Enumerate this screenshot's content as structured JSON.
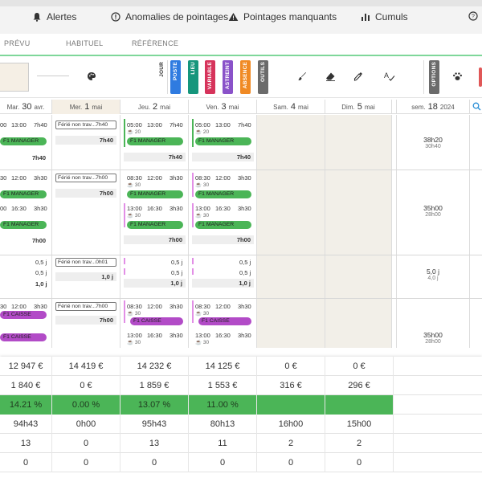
{
  "nav": {
    "alertes": "Alertes",
    "anomalies": "Anomalies de pointages",
    "manquants": "Pointages manquants",
    "cumuls": "Cumuls"
  },
  "subtabs": [
    "PRÉVU",
    "HABITUEL",
    "RÉFÉRENCE"
  ],
  "toolbar": {
    "jour": "JOUR",
    "tabs": [
      {
        "label": "POSTE",
        "color": "#2f7be0"
      },
      {
        "label": "LIEU",
        "color": "#16967c"
      },
      {
        "label": "VARIABLE",
        "color": "#d6335b"
      },
      {
        "label": "ASTREINT",
        "color": "#8a52c9"
      },
      {
        "label": "ABSENCE",
        "color": "#f08a24"
      },
      {
        "label": "OUTILS",
        "color": "#6b6b6b"
      }
    ],
    "options": "OPTIONS",
    "icons": [
      "palette-icon",
      "brush-icon",
      "eraser-icon",
      "eyedropper-icon",
      "spellcheck-icon",
      "paw-icon"
    ]
  },
  "days": [
    {
      "dow": "Mar.",
      "num": "30",
      "mon": "avr."
    },
    {
      "dow": "Mer.",
      "num": "1",
      "mon": "mai"
    },
    {
      "dow": "Jeu.",
      "num": "2",
      "mon": "mai"
    },
    {
      "dow": "Ven.",
      "num": "3",
      "mon": "mai"
    },
    {
      "dow": "Sam.",
      "num": "4",
      "mon": "mai"
    },
    {
      "dow": "Dim.",
      "num": "5",
      "mon": "mai"
    }
  ],
  "week": {
    "label": "sem.",
    "num": "18",
    "year": "2024"
  },
  "rows": {
    "r1": {
      "mar": {
        "times": [
          "00",
          "13:00",
          "7h40"
        ],
        "pill": "F1 MANAGER",
        "total": "7h40"
      },
      "mer": {
        "ferie": "Férié non trav...7h40",
        "total": "7h40"
      },
      "jeu": {
        "times": [
          "05:00",
          "13:00",
          "7h40"
        ],
        "sub": "20",
        "pill": "F1 MANAGER",
        "total": "7h40"
      },
      "ven": {
        "times": [
          "05:00",
          "13:00",
          "7h40"
        ],
        "sub": "20",
        "pill": "F1 MANAGER",
        "total": "7h40"
      },
      "week": {
        "big": "38h20",
        "small": "30h40"
      }
    },
    "r2": {
      "mar": {
        "a": [
          "30",
          "12:00",
          "3h30"
        ],
        "pill1": "F1 MANAGER",
        "b": [
          "00",
          "16:30",
          "3h30"
        ],
        "pill2": "F1 MANAGER",
        "total": "7h00"
      },
      "mer": {
        "ferie": "Férié non trav...7h00",
        "total": "7h00"
      },
      "jeu": {
        "a": [
          "08:30",
          "12:00",
          "3h30"
        ],
        "suba": "30",
        "pill1": "F1 MANAGER",
        "b": [
          "13:00",
          "16:30",
          "3h30"
        ],
        "subb": "30",
        "pill2": "F1 MANAGER",
        "total": "7h00"
      },
      "ven": {
        "a": [
          "08:30",
          "12:00",
          "3h30"
        ],
        "suba": "30",
        "pill1": "F1 MANAGER",
        "b": [
          "13:00",
          "16:30",
          "3h30"
        ],
        "subb": "30",
        "pill2": "F1 MANAGER",
        "total": "7h00"
      },
      "week": {
        "big": "35h00",
        "small": "28h00"
      }
    },
    "r3": {
      "mar": {
        "v1": "0,5 j",
        "v2": "0,5 j",
        "total": "1,0 j"
      },
      "mer": {
        "ferie": "Férié non trav...0h01",
        "total": "1,0 j"
      },
      "jeu": {
        "v1": "0,5 j",
        "v2": "0,5 j",
        "total": "1,0 j"
      },
      "ven": {
        "v1": "0,5 j",
        "v2": "0,5 j",
        "total": "1,0 j"
      },
      "week": {
        "big": "5,0 j",
        "small": "4,0 j"
      }
    },
    "r4": {
      "mar": {
        "a": [
          "30",
          "12:00",
          "3h30"
        ],
        "pill1": "F1 CAISSE",
        "pill2": "F1 CAISSE"
      },
      "mer": {
        "ferie": "Férié non trav...7h00",
        "total": "7h00"
      },
      "jeu": {
        "a": [
          "08:30",
          "12:00",
          "3h30"
        ],
        "suba": "30",
        "pill1": "F1 CAISSE",
        "b": [
          "13:00",
          "16:30",
          "3h30"
        ],
        "subb": "30"
      },
      "ven": {
        "a": [
          "08:30",
          "12:00",
          "3h30"
        ],
        "suba": "30",
        "pill1": "F1 CAISSE",
        "b": [
          "13:00",
          "16:30",
          "3h30"
        ],
        "subb": "30"
      },
      "week": {
        "big": "35h00",
        "small": "28h00"
      }
    }
  },
  "summary": [
    [
      "12 947 €",
      "14 419 €",
      "14 232 €",
      "14 125 €",
      "0 €",
      "0 €"
    ],
    [
      "1 840 €",
      "0 €",
      "1 859 €",
      "1 553 €",
      "316 €",
      "296 €"
    ],
    [
      "14.21 %",
      "0.00 %",
      "13.07 %",
      "11.00 %",
      "",
      ""
    ],
    [
      "94h43",
      "0h00",
      "95h43",
      "80h13",
      "16h00",
      "15h00"
    ],
    [
      "13",
      "0",
      "13",
      "11",
      "2",
      "2"
    ],
    [
      "0",
      "0",
      "0",
      "0",
      "0",
      "0"
    ]
  ],
  "colors": {
    "green": "#4bb557",
    "purple": "#b24bc7",
    "accent": "#7fd79a",
    "today": "#f5efe5"
  }
}
